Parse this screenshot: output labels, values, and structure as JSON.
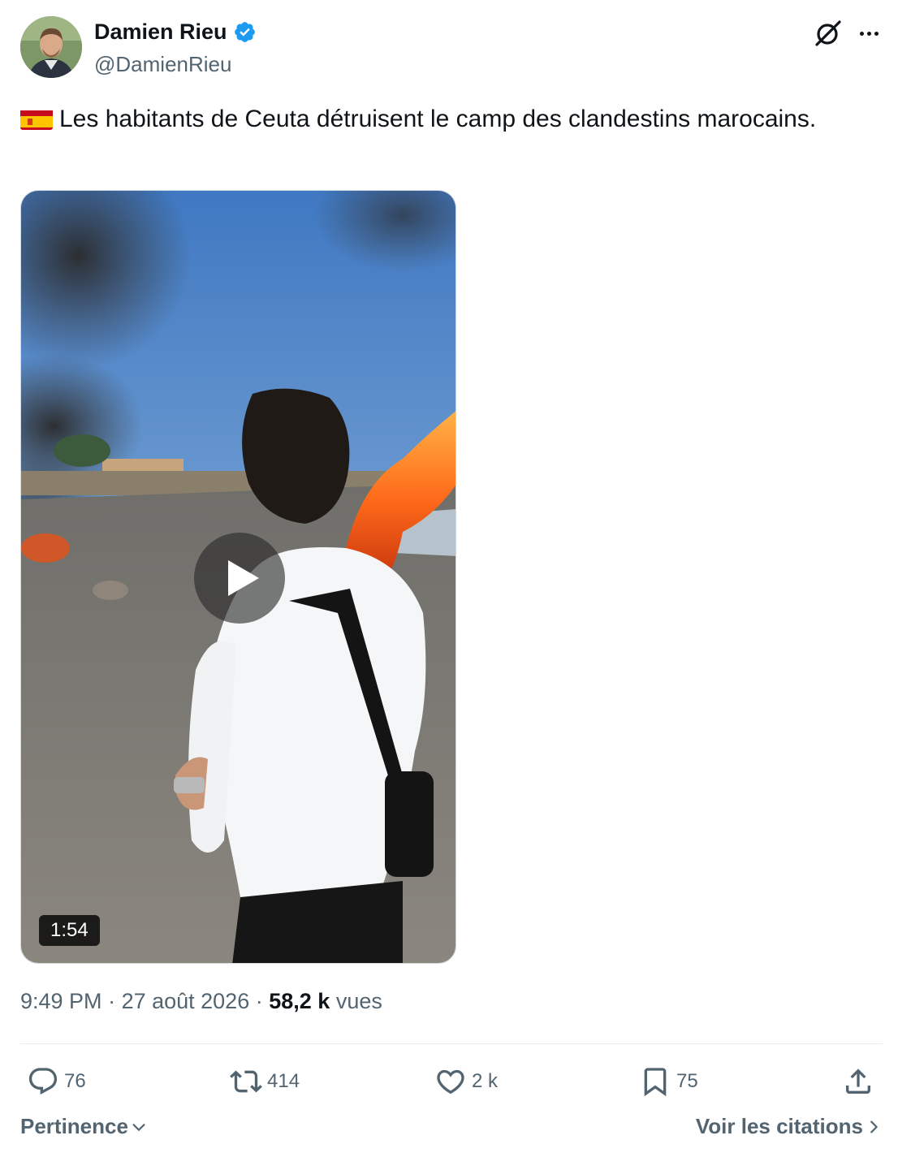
{
  "author": {
    "display_name": "Damien Rieu",
    "handle": "@DamienRieu",
    "verified": true,
    "verified_color": "#1d9bf0"
  },
  "tweet": {
    "flag_icon": "spain-flag-icon",
    "text": "Les habitants de Ceuta détruisent le camp des clandestins marocains."
  },
  "media": {
    "type": "video",
    "duration": "1:54"
  },
  "meta": {
    "time": "9:49 PM",
    "separator": " · ",
    "date": "27 août 2026",
    "views_count": "58,2 k",
    "views_label": "vues"
  },
  "actions": {
    "replies": "76",
    "reposts": "414",
    "likes": "2 k",
    "bookmarks": "75"
  },
  "footer": {
    "sort_label": "Pertinence",
    "quotes_label": "Voir les citations"
  },
  "colors": {
    "text_primary": "#0f1419",
    "text_secondary": "#536471",
    "divider": "#e6ecf0"
  }
}
